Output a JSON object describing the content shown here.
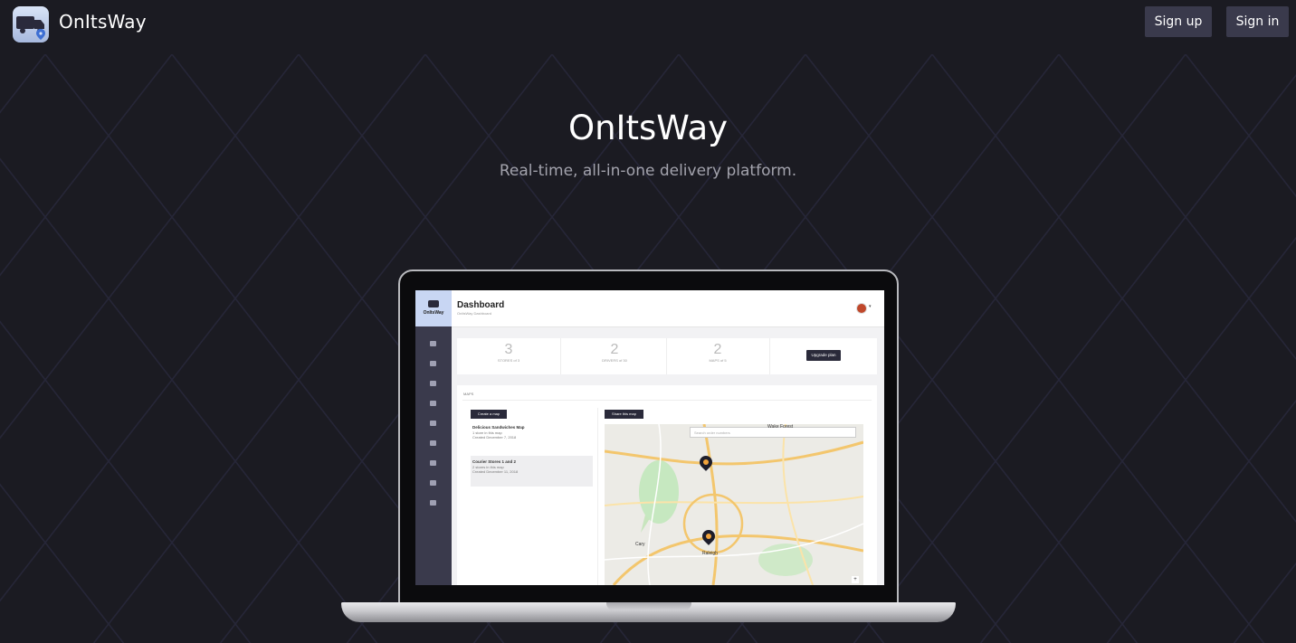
{
  "nav": {
    "brand": "OnItsWay",
    "signup_label": "Sign up",
    "signin_label": "Sign in"
  },
  "hero": {
    "title": "OnItsWay",
    "subtitle": "Real-time, all-in-one delivery platform."
  },
  "screenshot": {
    "logo_text": "OnItsWay",
    "header": {
      "title": "Dashboard",
      "subtitle": "OnItsWay Dashboard"
    },
    "stats": [
      {
        "value": "3",
        "label": "STORES of 3"
      },
      {
        "value": "2",
        "label": "DRIVERS of 30"
      },
      {
        "value": "2",
        "label": "MAPS of 5"
      }
    ],
    "upgrade_label": "Upgrade plan",
    "maps_heading": "MAPS",
    "create_map_label": "Create a map",
    "share_map_label": "Share this map",
    "map_items": [
      {
        "title": "Delicious Sandwiches Map",
        "stores": "1 store in this map",
        "created": "Created December 7, 2018"
      },
      {
        "title": "Courier Stores 1 and 2",
        "stores": "2 stores in this map",
        "created": "Created December 11, 2018"
      }
    ],
    "search_placeholder": "Search order numbers",
    "map_labels": {
      "city_1": "Raleigh",
      "city_2": "Cary",
      "city_3": "Wake Forest",
      "zoom_in": "+"
    }
  },
  "colors": {
    "background": "#1b1b22",
    "button": "#3a3a4c",
    "subtitle": "#a3a3ad"
  },
  "icons": [
    "delivery-truck-icon",
    "map-pin-icon"
  ]
}
